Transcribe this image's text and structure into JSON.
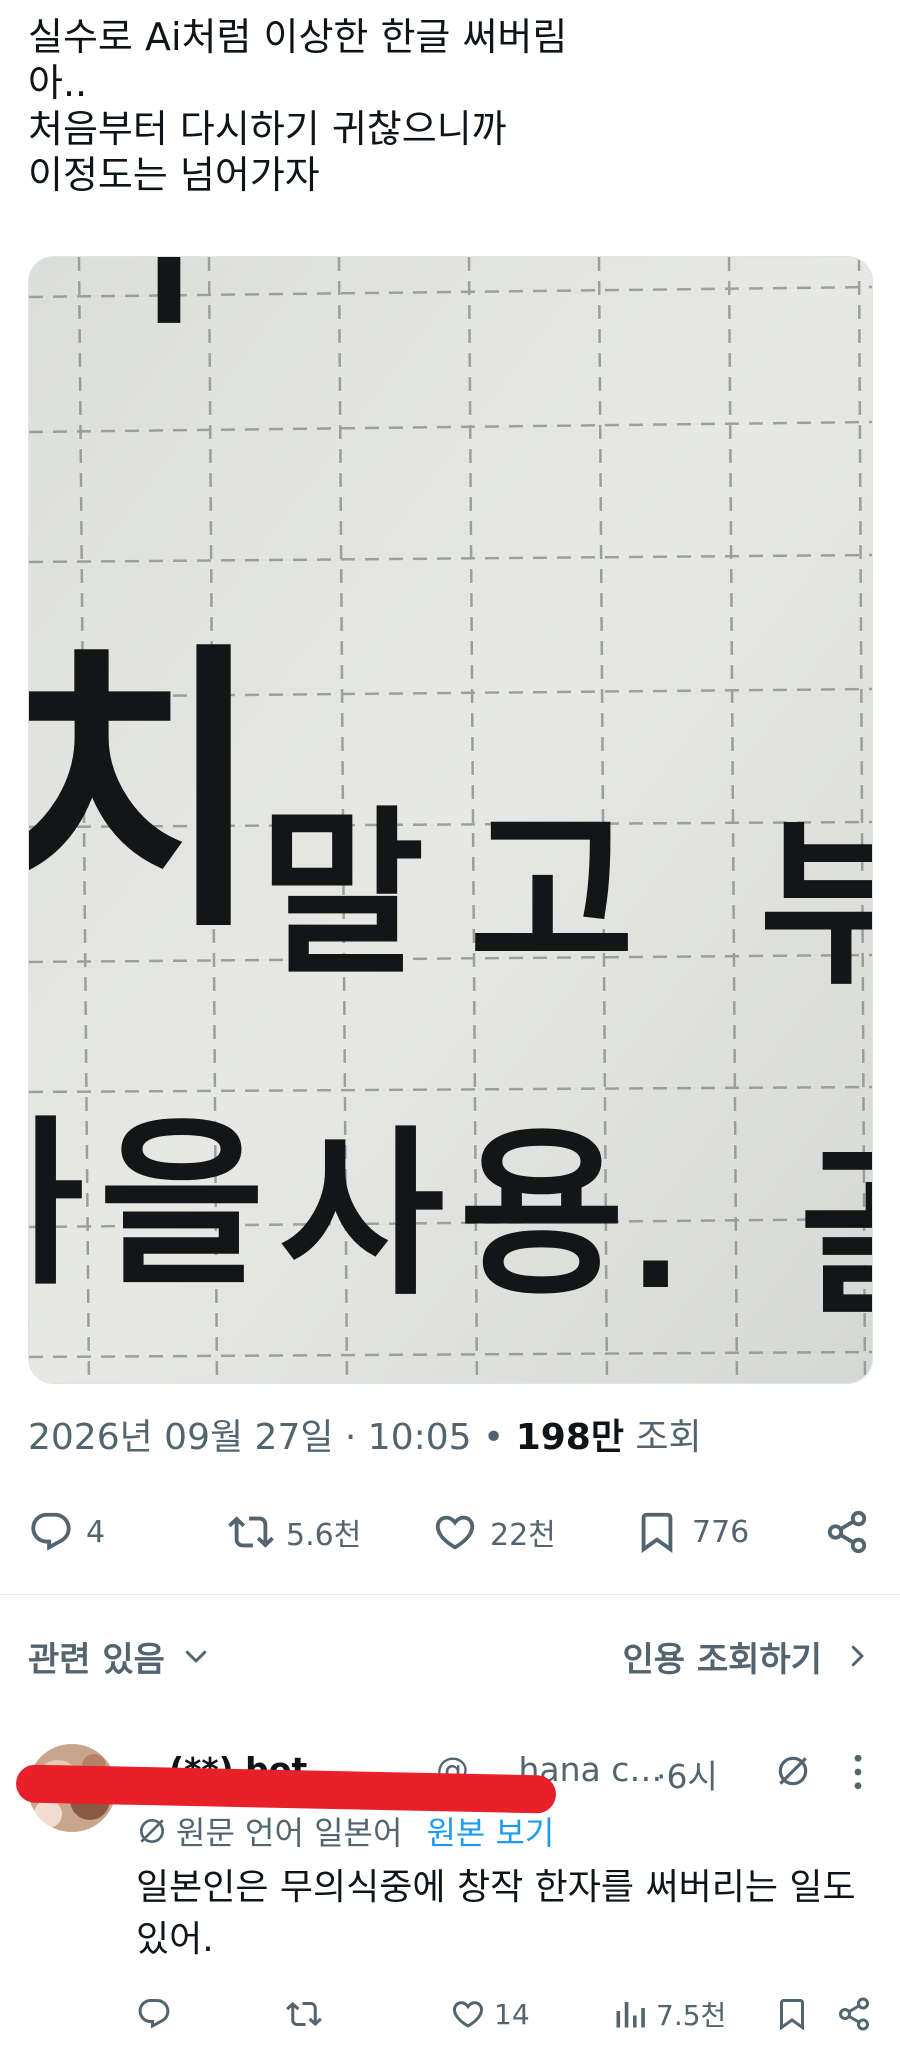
{
  "tweet": {
    "lines": [
      "실수로 Ai처럼 이상한 한글 써버림",
      "아..",
      "처음부터 다시하기 귀찮으니까",
      "이정도는 넘어가자"
    ],
    "photo": {
      "row1": [
        "말",
        "고",
        "부"
      ],
      "row2": [
        "을",
        "사",
        "용",
        "."
      ],
      "partial_left_top": "치",
      "partial_left_bottom": "나",
      "partial_right_bottom": "골"
    },
    "meta": {
      "date_time": "2026년 09월 27일 · 10:05",
      "separator": " • ",
      "views_count": "198만",
      "views_label": "조회"
    },
    "actions": {
      "replies": "4",
      "reposts": "5.6천",
      "likes": "22천",
      "bookmarks": "776"
    }
  },
  "related": {
    "label": "관련 있음",
    "quotes_label": "인용 조회하기"
  },
  "reply": {
    "name": "…(**) bot",
    "handle": "@___hana c…",
    "time_sep": "·",
    "time": "6시",
    "translate": {
      "label": "원문 언어 일본어",
      "show_original": "원본 보기"
    },
    "body": "일본인은 무의식중에 창작 한자를 써버리는 일도 있어.",
    "actions": {
      "replies": "",
      "reposts": "",
      "likes": "14",
      "views": "7.5천"
    }
  },
  "colors": {
    "text": "#0f1419",
    "secondary": "#536471",
    "link": "#1d9bf0",
    "redaction": "#e8202a"
  }
}
